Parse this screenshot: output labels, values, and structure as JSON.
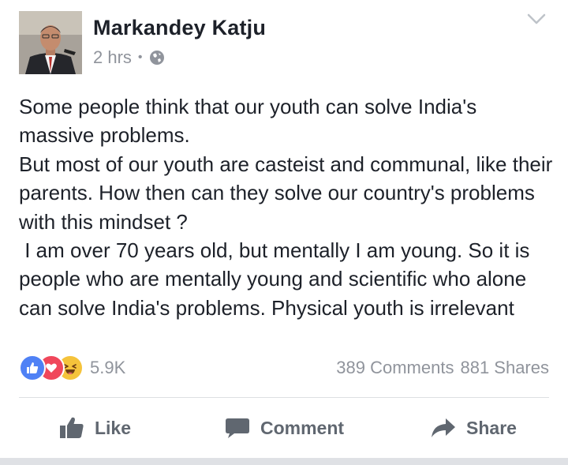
{
  "post": {
    "author": "Markandey Katju",
    "timestamp": "2 hrs",
    "privacy_separator": "•",
    "privacy_icon": "globe-icon",
    "text": "Some people think that our youth can solve India's massive problems.\nBut most of our youth are casteist and communal, like their parents. How then can they solve our country's problems with this mindset ?\n I am over 70 years old, but mentally I am young. So it is people who are mentally young and scientific who alone can solve India's problems. Physical youth is irrelevant",
    "reactions": {
      "icons": [
        "like-reaction-icon",
        "love-reaction-icon",
        "haha-reaction-icon"
      ],
      "count": "5.9K"
    },
    "comments_count": "389 Comments",
    "shares_count": "881 Shares"
  },
  "actions": {
    "like_label": "Like",
    "comment_label": "Comment",
    "share_label": "Share"
  },
  "colors": {
    "text": "#1d2129",
    "secondary": "#90949c",
    "action": "#606770",
    "like_reaction": "#4f81f5",
    "love_reaction": "#f0475b",
    "haha_reaction": "#f5c33b",
    "divider": "#dddfe2"
  }
}
